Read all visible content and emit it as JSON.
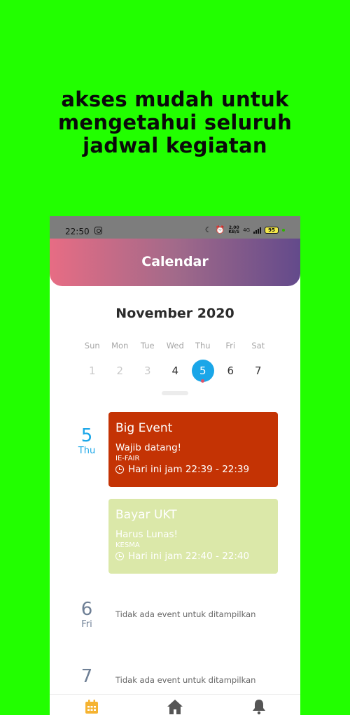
{
  "promo": {
    "line1": "akses mudah untuk",
    "line2": "mengetahui seluruh",
    "line3": "jadwal kegiatan"
  },
  "status_bar": {
    "time": "22:50",
    "speed_top": "2.00",
    "speed_bottom": "KB/S",
    "network": "4G",
    "battery": "95"
  },
  "app_bar": {
    "title": "Calendar"
  },
  "calendar": {
    "month_label": "November 2020",
    "weekdays": [
      "Sun",
      "Mon",
      "Tue",
      "Wed",
      "Thu",
      "Fri",
      "Sat"
    ],
    "days": [
      "1",
      "2",
      "3",
      "4",
      "5",
      "6",
      "7"
    ],
    "selected_day": "5"
  },
  "agenda": [
    {
      "day_number": "5",
      "weekday": "Thu",
      "events": [
        {
          "title": "Big Event",
          "subtitle": "Wajib datang!",
          "organizer": "IE-FAIR",
          "time": "Hari ini jam 22:39 - 22:39",
          "color": "#c43304"
        },
        {
          "title": "Bayar UKT",
          "subtitle": "Harus Lunas!",
          "organizer": "KESMA",
          "time": "Hari ini jam 22:40 - 22:40",
          "color": "#dbe8a9"
        }
      ]
    },
    {
      "day_number": "6",
      "weekday": "Fri",
      "empty_text": "Tidak ada event untuk ditampilkan"
    },
    {
      "day_number": "7",
      "weekday": "",
      "empty_text": "Tidak ada event untuk ditampilkan"
    }
  ],
  "bottom_nav": [
    {
      "icon": "calendar-icon",
      "active": true,
      "color": "#f5b331"
    },
    {
      "icon": "home-icon",
      "active": false,
      "color": "#555555"
    },
    {
      "icon": "bell-icon",
      "active": false,
      "color": "#555555"
    }
  ],
  "colors": {
    "background": "#22ff00",
    "accent": "#1aa6e8",
    "gradient_start": "#e76c84",
    "gradient_end": "#634a8b"
  }
}
